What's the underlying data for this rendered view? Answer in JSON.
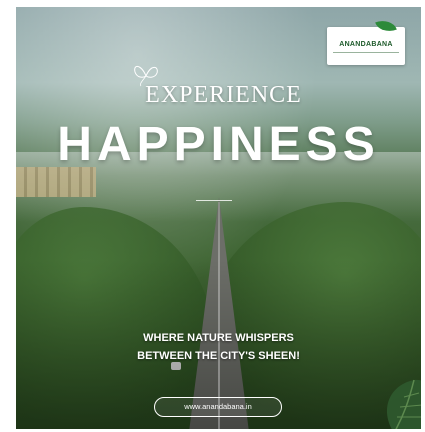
{
  "brand": {
    "logo_text": "ANANDABANA",
    "logo_icon": "leaf-icon"
  },
  "headline": {
    "kicker": "EXPERIENCE",
    "main": "HAPPINESS"
  },
  "tagline": {
    "line1": "WHERE NATURE WHISPERS",
    "line2": "BETWEEN THE CITY'S SHEEN!"
  },
  "website": "www.anandabana.in",
  "colors": {
    "brand_green": "#1d5a2a",
    "text": "#ffffff"
  }
}
